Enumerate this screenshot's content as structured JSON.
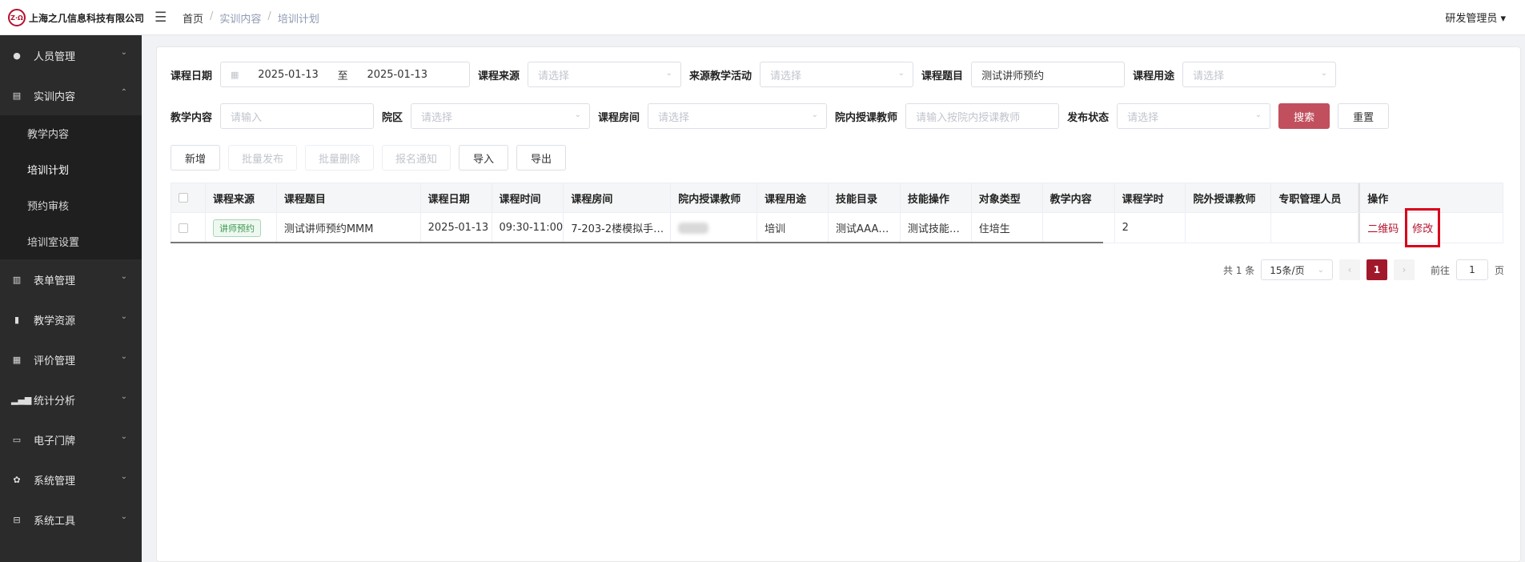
{
  "header": {
    "logo_mark": "Z·Ω",
    "company": "上海之几信息科技有限公司",
    "breadcrumb": [
      "首页",
      "实训内容",
      "培训计划"
    ],
    "user": "研发管理员"
  },
  "sidebar": {
    "items": [
      {
        "label": "人员管理",
        "icon": "people-icon",
        "expanded": false
      },
      {
        "label": "实训内容",
        "icon": "book-icon",
        "expanded": true,
        "children": [
          {
            "label": "教学内容",
            "active": false
          },
          {
            "label": "培训计划",
            "active": true
          },
          {
            "label": "预约审核",
            "active": false
          },
          {
            "label": "培训室设置",
            "active": false
          }
        ]
      },
      {
        "label": "表单管理",
        "icon": "form-icon",
        "expanded": false
      },
      {
        "label": "教学资源",
        "icon": "resource-icon",
        "expanded": false
      },
      {
        "label": "评价管理",
        "icon": "rating-icon",
        "expanded": false
      },
      {
        "label": "统计分析",
        "icon": "bar-chart-icon",
        "expanded": false
      },
      {
        "label": "电子门牌",
        "icon": "monitor-icon",
        "expanded": false
      },
      {
        "label": "系统管理",
        "icon": "gear-icon",
        "expanded": false
      },
      {
        "label": "系统工具",
        "icon": "toolbox-icon",
        "expanded": false
      }
    ]
  },
  "filters": {
    "course_date_label": "课程日期",
    "date_start": "2025-01-13",
    "date_sep": "至",
    "date_end": "2025-01-13",
    "course_source_label": "课程来源",
    "course_source_placeholder": "请选择",
    "source_activity_label": "来源教学活动",
    "source_activity_placeholder": "请选择",
    "course_title_label": "课程题目",
    "course_title_value": "测试讲师预约",
    "course_use_label": "课程用途",
    "course_use_placeholder": "请选择",
    "teaching_content_label": "教学内容",
    "teaching_content_placeholder": "请输入",
    "campus_label": "院区",
    "campus_placeholder": "请选择",
    "room_label": "课程房间",
    "room_placeholder": "请选择",
    "teacher_label": "院内授课教师",
    "teacher_placeholder": "请输入按院内授课教师",
    "status_label": "发布状态",
    "status_placeholder": "请选择",
    "search_btn": "搜索",
    "reset_btn": "重置"
  },
  "toolbar": {
    "add": "新增",
    "batch_publish": "批量发布",
    "batch_delete": "批量删除",
    "signup_notice": "报名通知",
    "import": "导入",
    "export": "导出"
  },
  "table": {
    "headers": [
      "课程来源",
      "课程题目",
      "课程日期",
      "课程时间",
      "课程房间",
      "院内授课教师",
      "课程用途",
      "技能目录",
      "技能操作",
      "对象类型",
      "教学内容",
      "课程学时",
      "院外授课教师",
      "专职管理人员",
      "操作"
    ],
    "rows": [
      {
        "source": "讲师预约",
        "title": "测试讲师预约MMM",
        "date": "2025-01-13",
        "time": "09:30-11:00",
        "room": "7-203-2楼模拟手…",
        "teacher": "",
        "use": "培训",
        "skill_dir": "测试AAA…",
        "skill_op": "测试技能…",
        "target": "住培生",
        "content": "",
        "hours": "2",
        "ext_teacher": "",
        "manager": "",
        "action_qr": "二维码",
        "action_edit": "修改"
      }
    ]
  },
  "pagination": {
    "total": "共 1 条",
    "page_size": "15条/页",
    "prev": "‹",
    "current": "1",
    "next": "›",
    "goto_label": "前往",
    "goto_value": "1",
    "page_suffix": "页"
  }
}
